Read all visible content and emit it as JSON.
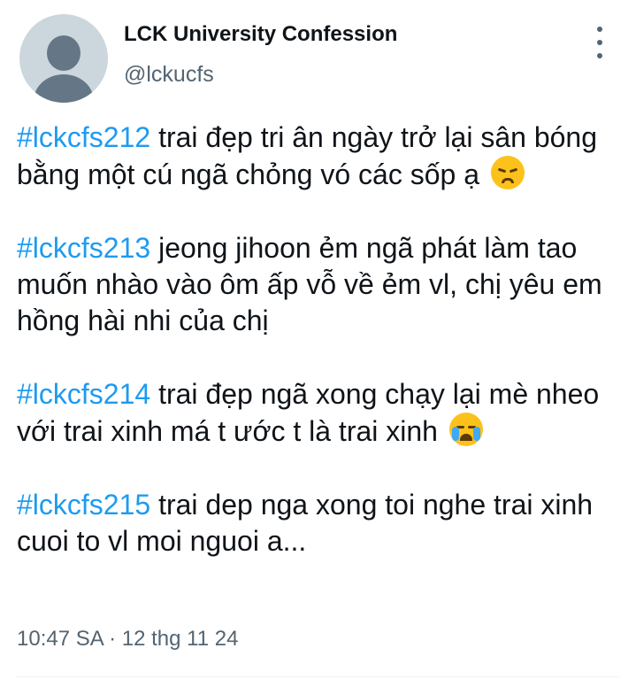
{
  "account": {
    "name": "LCK University Confession",
    "handle": "@lckucfs"
  },
  "icons": {
    "avatar": "default-avatar-icon",
    "more": "more-options-icon",
    "emoji_sad": "disappointed-face-emoji",
    "emoji_cry": "loudly-crying-face-emoji"
  },
  "colors": {
    "hashtag": "#1d9bf0",
    "secondary_text": "#536471"
  },
  "tweet": {
    "paragraphs": [
      {
        "hashtag": "#lckcfs212",
        "text": " trai đẹp tri ân ngày trở lại sân bóng bằng một cú ngã chỏng vó các sốp ạ "
      },
      {
        "hashtag": "#lckcfs213",
        "text": " jeong jihoon ẻm ngã phát làm tao muốn nhào vào ôm ấp vỗ về ẻm vl, chị yêu em hồng hài nhi của chị"
      },
      {
        "hashtag": "#lckcfs214",
        "text": " trai đẹp ngã xong chạy lại mè nheo với trai xinh má t ước t là trai xinh "
      },
      {
        "hashtag": "#lckcfs215",
        "text": " trai dep nga xong toi nghe trai xinh cuoi to vl moi nguoi a..."
      }
    ],
    "timestamp": "10:47 SA · 12 thg 11 24"
  }
}
